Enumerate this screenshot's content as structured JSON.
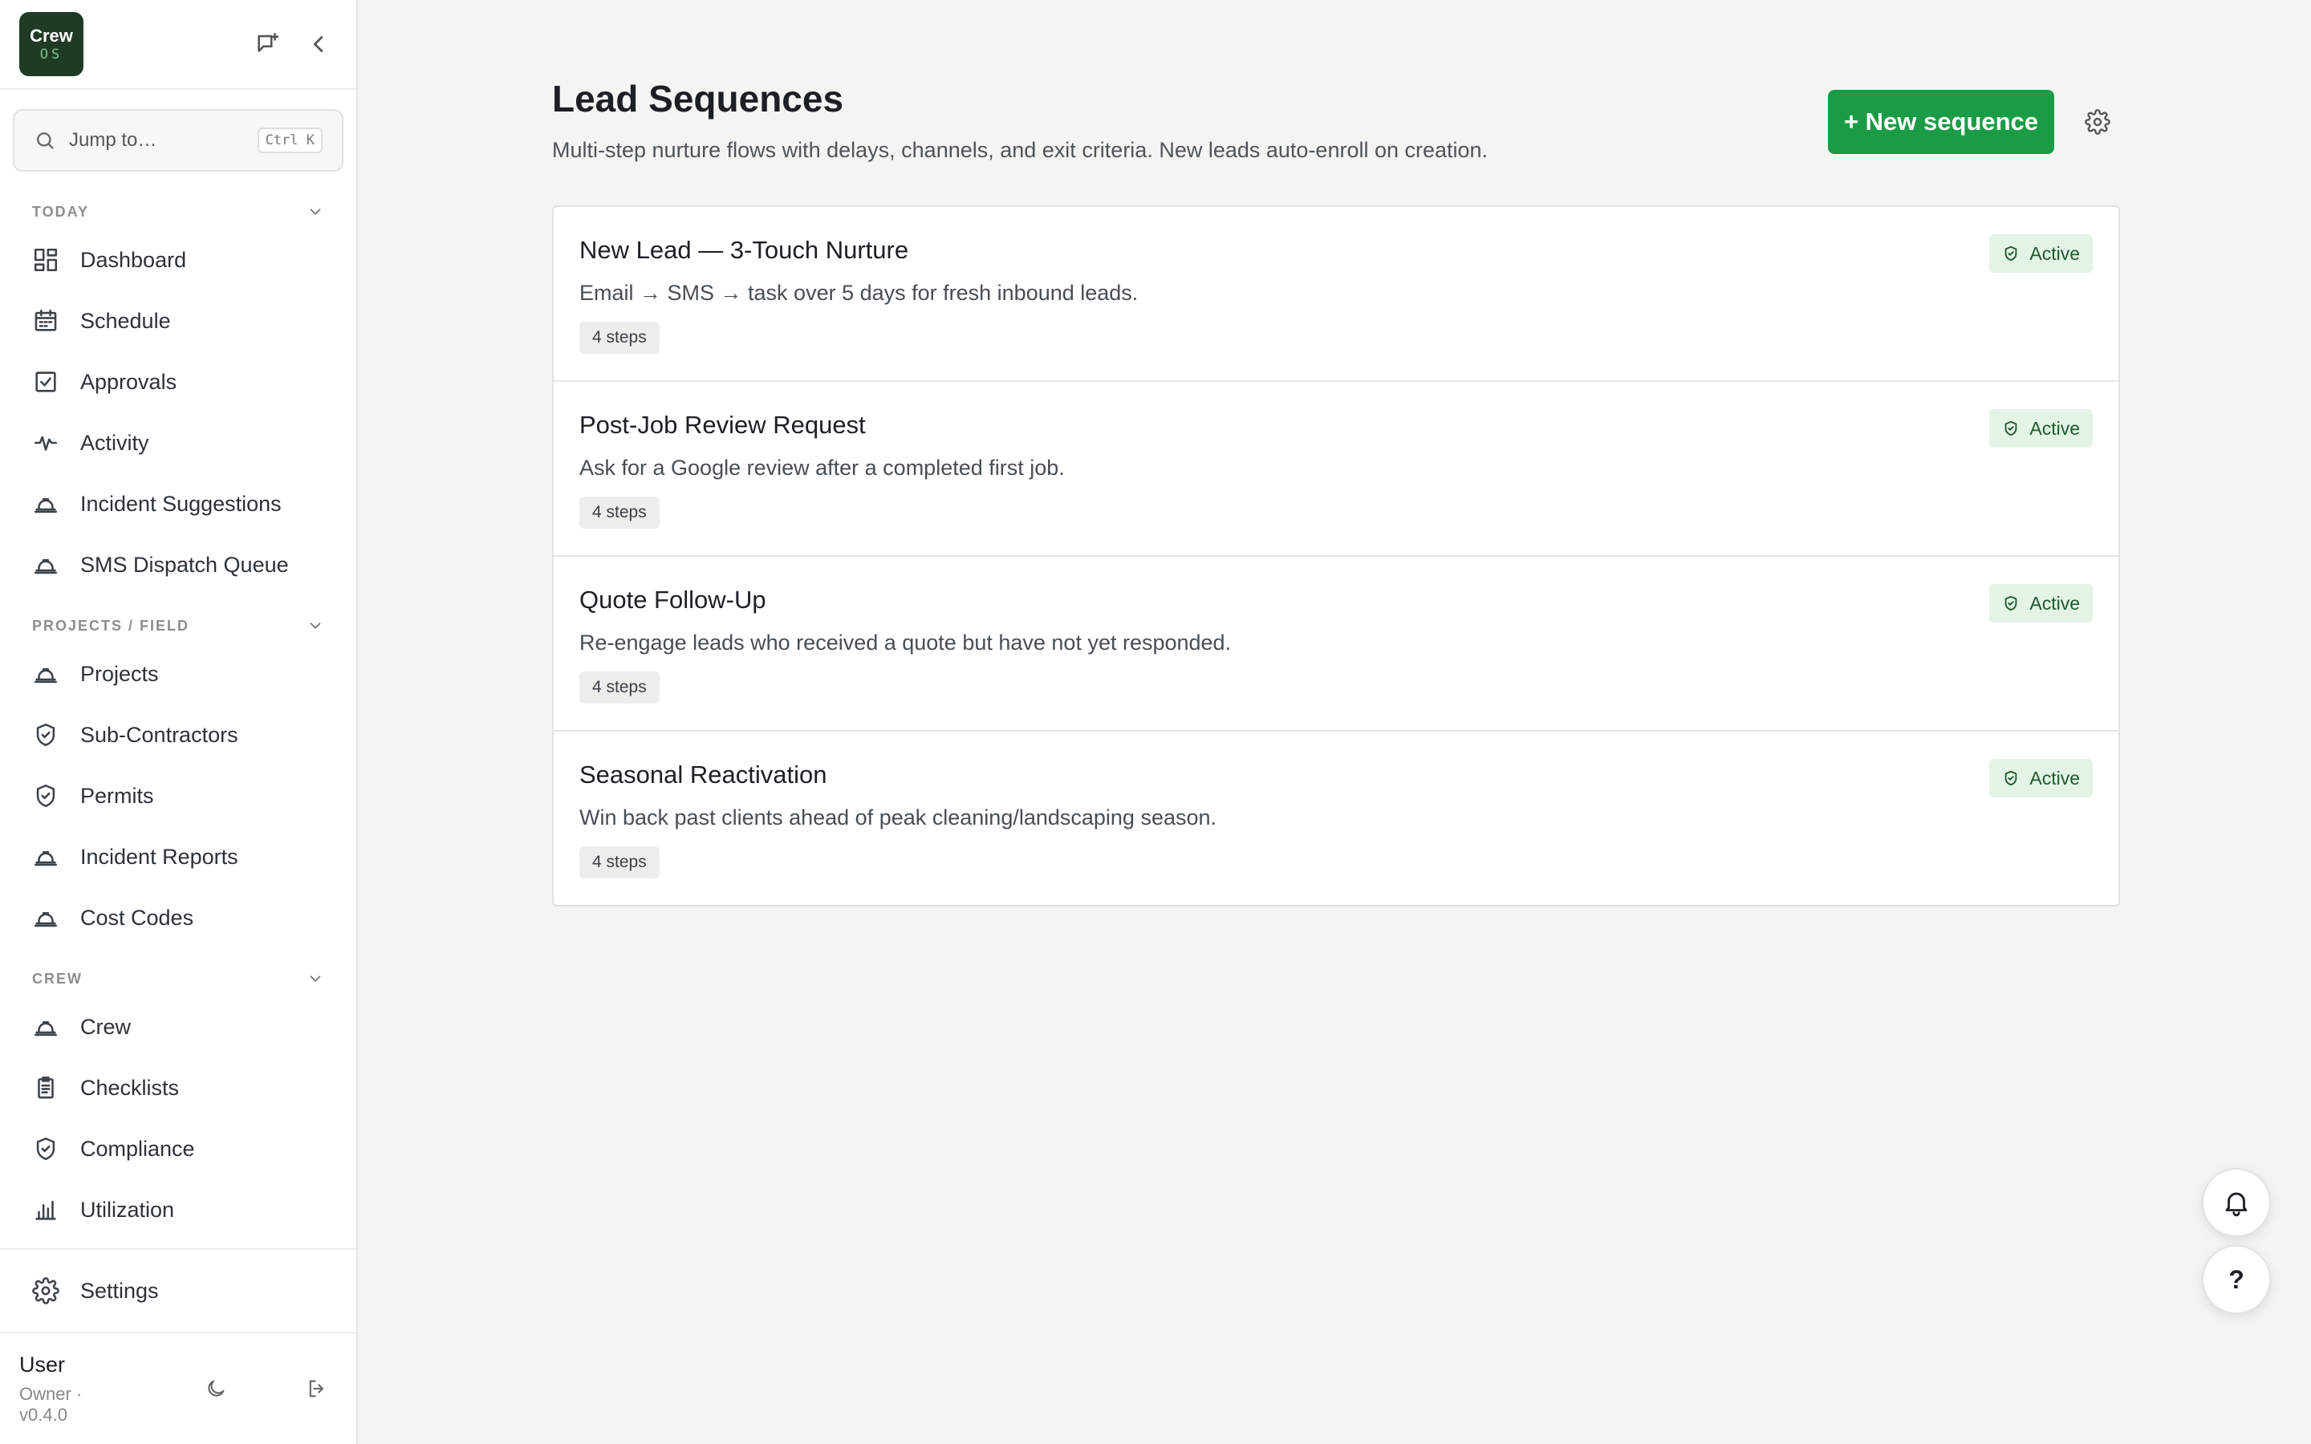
{
  "brand": {
    "line1": "Crew",
    "line2": "OS"
  },
  "search": {
    "placeholder": "Jump to…",
    "shortcut": "Ctrl K"
  },
  "sidebar": {
    "sections": [
      {
        "title": "TODAY",
        "items": [
          {
            "label": "Dashboard",
            "icon": "dashboard-icon"
          },
          {
            "label": "Schedule",
            "icon": "calendar-icon"
          },
          {
            "label": "Approvals",
            "icon": "checkbox-icon"
          },
          {
            "label": "Activity",
            "icon": "activity-icon"
          },
          {
            "label": "Incident Suggestions",
            "icon": "hardhat-icon"
          },
          {
            "label": "SMS Dispatch Queue",
            "icon": "hardhat-icon"
          }
        ]
      },
      {
        "title": "PROJECTS / FIELD",
        "items": [
          {
            "label": "Projects",
            "icon": "hardhat-icon"
          },
          {
            "label": "Sub-Contractors",
            "icon": "shield-icon"
          },
          {
            "label": "Permits",
            "icon": "shield-icon"
          },
          {
            "label": "Incident Reports",
            "icon": "hardhat-icon"
          },
          {
            "label": "Cost Codes",
            "icon": "hardhat-icon"
          }
        ]
      },
      {
        "title": "CREW",
        "items": [
          {
            "label": "Crew",
            "icon": "hardhat-icon"
          },
          {
            "label": "Checklists",
            "icon": "clipboard-icon"
          },
          {
            "label": "Compliance",
            "icon": "shield-icon"
          },
          {
            "label": "Utilization",
            "icon": "bar-chart-icon"
          }
        ]
      }
    ],
    "settings_label": "Settings",
    "user": {
      "name": "User",
      "meta": "Owner · v0.4.0"
    }
  },
  "page": {
    "title": "Lead Sequences",
    "subtitle": "Multi-step nurture flows with delays, channels, and exit criteria. New leads auto-enroll on creation.",
    "new_button": "+ New sequence"
  },
  "sequences": [
    {
      "name": "New Lead — 3-Touch Nurture",
      "description": "Email → SMS → task over 5 days for fresh inbound leads.",
      "steps": "4 steps",
      "status": "Active"
    },
    {
      "name": "Post-Job Review Request",
      "description": "Ask for a Google review after a completed first job.",
      "steps": "4 steps",
      "status": "Active"
    },
    {
      "name": "Quote Follow-Up",
      "description": "Re-engage leads who received a quote but have not yet responded.",
      "steps": "4 steps",
      "status": "Active"
    },
    {
      "name": "Seasonal Reactivation",
      "description": "Win back past clients ahead of peak cleaning/landscaping season.",
      "steps": "4 steps",
      "status": "Active"
    }
  ],
  "floating": {
    "help_label": "?"
  },
  "colors": {
    "accent": "#1a9c47",
    "badge_bg": "#e3f3e6",
    "badge_text": "#1f5a2c",
    "logo_bg": "#1f3b23"
  }
}
